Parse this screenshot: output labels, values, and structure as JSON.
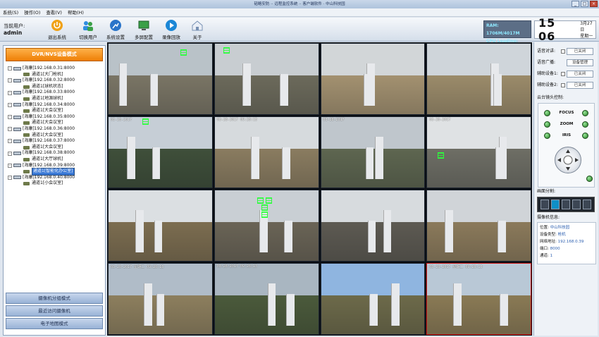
{
  "window": {
    "title": "韬略安防 ·· 远程监控系统 ·· 客户端软件 · 中山科技园"
  },
  "menu": [
    "系统(S)",
    "操作(O)",
    "查看(V)",
    "帮助(H)"
  ],
  "user": {
    "label": "当前用户:",
    "name": "admin"
  },
  "toolbar": [
    {
      "label": "退出系统",
      "icon": "power-icon",
      "color": "#f0a116"
    },
    {
      "label": "切换用户",
      "icon": "switch-user-icon",
      "color": "#2f8de0"
    },
    {
      "label": "系统设置",
      "icon": "settings-icon",
      "color": "#2a74c9"
    },
    {
      "label": "多屏配置",
      "icon": "multi-screen-icon",
      "color": "#3aa047"
    },
    {
      "label": "录像回放",
      "icon": "playback-icon",
      "color": "#1b87d6"
    },
    {
      "label": "关于",
      "icon": "home-icon",
      "color": "#7790b3"
    }
  ],
  "sysinfo": {
    "ram": "RAM: 1706M/4017M",
    "cpu": "CPU Loading: 12%"
  },
  "clock": {
    "time": "15 06",
    "date": "3月27日",
    "weekday": "星期一"
  },
  "left": {
    "mode_title": "DVR/NVS设备模式",
    "bottom_buttons": [
      "摄像机分组模式",
      "最近访问摄像机",
      "电子地图模式"
    ]
  },
  "tree": [
    {
      "device": "[海康]192.168.0.31:8000",
      "channel": "通道1[大门枪机]"
    },
    {
      "device": "[海康]192.168.0.32:8000",
      "channel": "通道1[球机状态]"
    },
    {
      "device": "[海康]192.168.0.33:8000",
      "channel": "通道1[地源球机]"
    },
    {
      "device": "[海康]192.168.0.34:8000",
      "channel": "通道1[大会议室]"
    },
    {
      "device": "[海康]192.168.0.35:8000",
      "channel": "通道1[大会议室]"
    },
    {
      "device": "[海康]192.168.0.36:8000",
      "channel": "通道1[大会议室]"
    },
    {
      "device": "[海康]192.168.0.37:8000",
      "channel": "通道1[大会议室]"
    },
    {
      "device": "[海康]192.168.0.38:8000",
      "channel": "通道1[大厅球机]"
    },
    {
      "device": "[海康]192.168.0.39:8000",
      "channel": "通道1[智能化办公室]"
    },
    {
      "device": "[海康]192.168.0.40:8000",
      "channel": "通道1[小会议室]"
    }
  ],
  "tree_selected_index": 8,
  "grid": [
    {
      "ts": "",
      "sky": "#b9c2c8",
      "ground": "#7a7565"
    },
    {
      "ts": "",
      "sky": "#c8cdd1",
      "ground": "#6c6a5b"
    },
    {
      "ts": "",
      "sky": "#d2d6d8",
      "ground": "#a39170"
    },
    {
      "ts": "",
      "sky": "#cfd5da",
      "ground": "#9b8b6a"
    },
    {
      "ts": "03-28-2017",
      "sky": "#c6ced6",
      "ground": "#3f4f3a"
    },
    {
      "ts": "03-28-2017 09:28:13",
      "sky": "#d6dadd",
      "ground": "#8a7c60"
    },
    {
      "ts": "03-28-2017",
      "sky": "#bfc6cc",
      "ground": "#5e6650"
    },
    {
      "ts": "03-28-2017",
      "sky": "#dfe2e4",
      "ground": "#6e6e65"
    },
    {
      "ts": "",
      "sky": "#dbdfe2",
      "ground": "#7c6d50"
    },
    {
      "ts": "",
      "sky": "#c9cfd4",
      "ground": "#6a6456"
    },
    {
      "ts": "",
      "sky": "#d7dbde",
      "ground": "#5d5a52"
    },
    {
      "ts": "",
      "sky": "#d0d4d8",
      "ground": "#8b7a5b"
    },
    {
      "ts": "03-28-2017 星期二 09:28:13",
      "sky": "#b0bcc8",
      "ground": "#8d7f5e"
    },
    {
      "ts": "03-28-2017 09:28:13",
      "sky": "#a9b6c1",
      "ground": "#4b5a3b"
    },
    {
      "ts": "",
      "sky": "#8fb5e0",
      "ground": "#6d6a4a"
    },
    {
      "ts": "03-28-2017 星期二 09:28:13",
      "sky": "#b9c8d6",
      "ground": "#8a7a55"
    }
  ],
  "selected_cell": 15,
  "right": {
    "rows": [
      {
        "label": "语音对讲:",
        "button": "已关闭"
      },
      {
        "label": "语音广播:",
        "button": "设备管理"
      },
      {
        "label": "辅助设备1:",
        "button": "已关闭"
      },
      {
        "label": "辅助设备2:",
        "button": "已关闭"
      }
    ],
    "ptz_title": "云台镜头控制:",
    "ptz_labels": [
      "FOCUS",
      "ZOOM",
      "IRIS"
    ],
    "split_title": "画面分割:",
    "caminfo_title": "摄像机信息:",
    "caminfo": [
      {
        "k": "位置:",
        "v": "中山科技园"
      },
      {
        "k": "设备类型:",
        "v": "枪机"
      },
      {
        "k": "网络地址:",
        "v": "192.168.0.39"
      },
      {
        "k": "端口:",
        "v": "8000"
      },
      {
        "k": "通道:",
        "v": "1"
      }
    ]
  }
}
